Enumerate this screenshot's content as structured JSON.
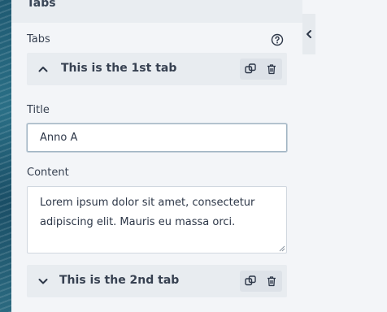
{
  "panel": {
    "title": "Tabs"
  },
  "tabs_field": {
    "label": "Tabs"
  },
  "tabs": [
    {
      "label": "This is the 1st tab",
      "expanded": true
    },
    {
      "label": "This is the 2nd tab",
      "expanded": false
    }
  ],
  "form": {
    "title_label": "Title",
    "title_value": "Anno A",
    "content_label": "Content",
    "content_value": "Lorem ipsum dolor sit amet, consectetur adipiscing elit. Mauris eu massa orci."
  },
  "icons": {
    "help": "question-circle-icon",
    "expand": "chevron-up-icon",
    "collapse": "chevron-down-icon",
    "duplicate": "duplicate-icon",
    "delete": "trash-icon",
    "sidebar_toggle": "chevron-left-icon"
  }
}
